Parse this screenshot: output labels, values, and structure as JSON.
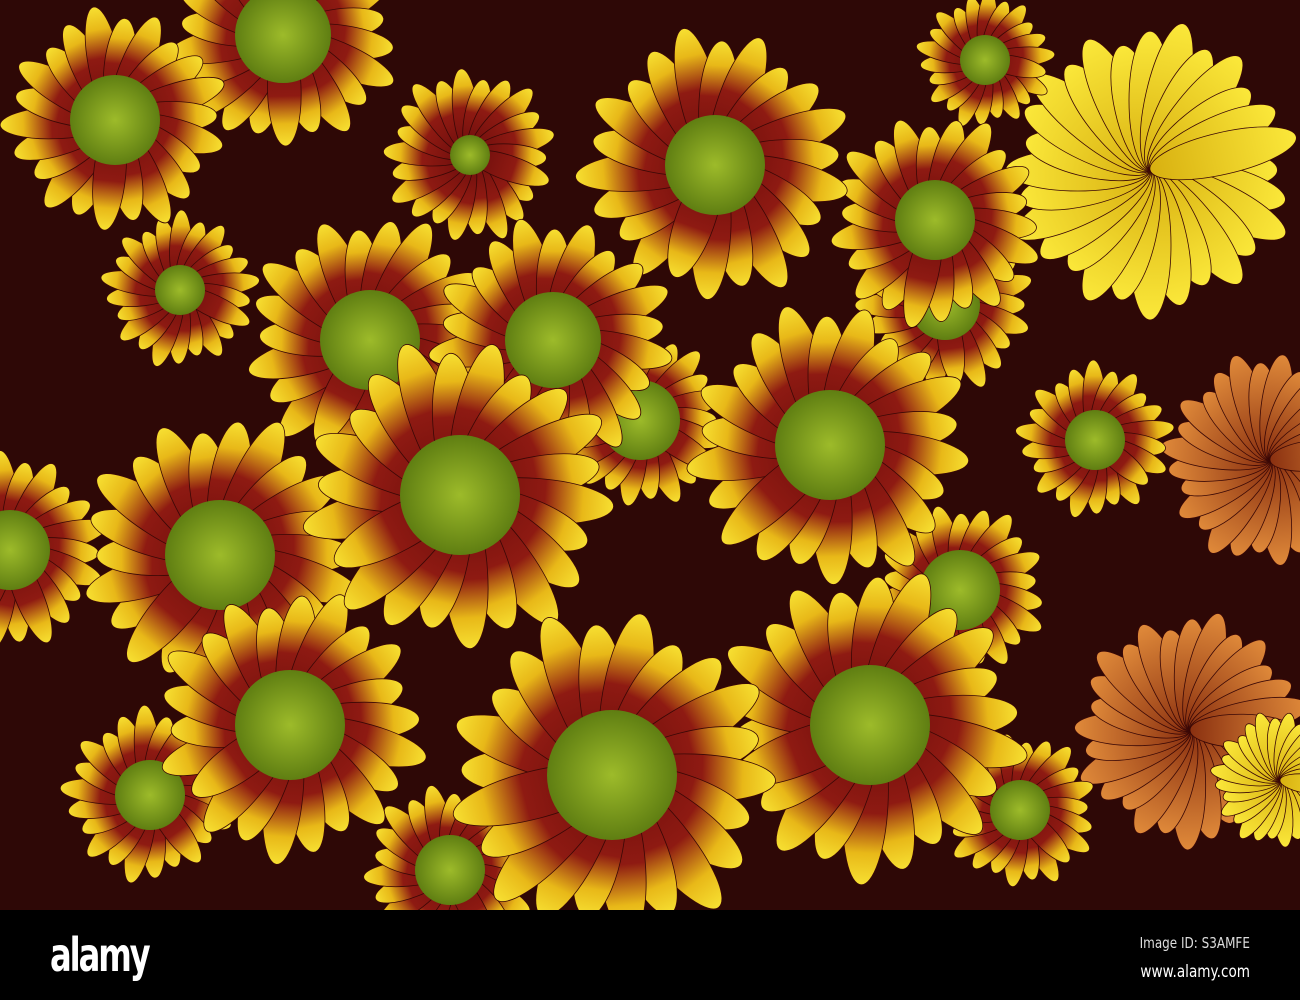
{
  "watermark": {
    "logo": "alamy",
    "image_id": "Image ID: S3AMFE",
    "url": "www.alamy.com"
  },
  "colors": {
    "petal_base": "#7a0f10",
    "petal_tip": "#f2d21a",
    "center": "#7fa21c",
    "yellow_flower": "#f5df20",
    "rust_flower": "#c0561e"
  }
}
